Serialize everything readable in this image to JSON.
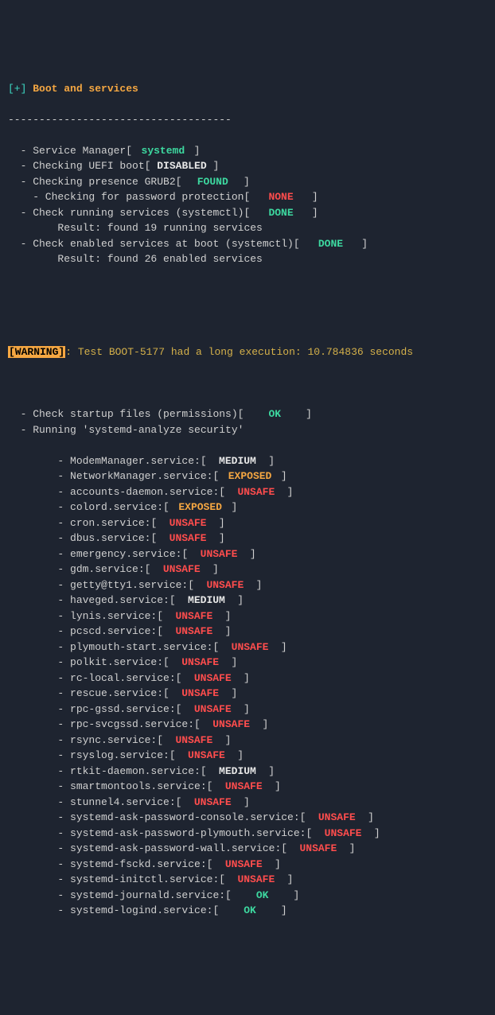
{
  "header": {
    "prefix": "[+]",
    "title": "Boot and services",
    "divider": "------------------------------------"
  },
  "top_checks": [
    {
      "indent": "  - ",
      "label": "Service Manager",
      "status": "systemd",
      "cls": "green"
    },
    {
      "indent": "  - ",
      "label": "Checking UEFI boot",
      "status": "DISABLED",
      "cls": "white"
    },
    {
      "indent": "  - ",
      "label": "Checking presence GRUB2",
      "status": "FOUND",
      "cls": "green"
    },
    {
      "indent": "    - ",
      "label": "Checking for password protection",
      "status": "NONE",
      "cls": "red"
    },
    {
      "indent": "  - ",
      "label": "Check running services (systemctl)",
      "status": "DONE",
      "cls": "green"
    },
    {
      "indent": "        ",
      "label": "Result: found 19 running services",
      "status": null
    },
    {
      "indent": "  - ",
      "label": "Check enabled services at boot (systemctl)",
      "status": "DONE",
      "cls": "green"
    },
    {
      "indent": "        ",
      "label": "Result: found 26 enabled services",
      "status": null
    }
  ],
  "warning": {
    "tag": "[WARNING]",
    "text": ": Test BOOT-5177 had a long execution: 10.784836 seconds"
  },
  "mid_checks": [
    {
      "indent": "  - ",
      "label": "Check startup files (permissions)",
      "status": "OK",
      "cls": "green"
    },
    {
      "indent": "  - ",
      "label": "Running 'systemd-analyze security'",
      "status": null
    }
  ],
  "services": [
    {
      "name": "ModemManager.service:",
      "status": "MEDIUM",
      "cls": "white"
    },
    {
      "name": "NetworkManager.service:",
      "status": "EXPOSED",
      "cls": "orange"
    },
    {
      "name": "accounts-daemon.service:",
      "status": "UNSAFE",
      "cls": "red"
    },
    {
      "name": "colord.service:",
      "status": "EXPOSED",
      "cls": "orange"
    },
    {
      "name": "cron.service:",
      "status": "UNSAFE",
      "cls": "red"
    },
    {
      "name": "dbus.service:",
      "status": "UNSAFE",
      "cls": "red"
    },
    {
      "name": "emergency.service:",
      "status": "UNSAFE",
      "cls": "red"
    },
    {
      "name": "gdm.service:",
      "status": "UNSAFE",
      "cls": "red"
    },
    {
      "name": "getty@tty1.service:",
      "status": "UNSAFE",
      "cls": "red"
    },
    {
      "name": "haveged.service:",
      "status": "MEDIUM",
      "cls": "white"
    },
    {
      "name": "lynis.service:",
      "status": "UNSAFE",
      "cls": "red"
    },
    {
      "name": "pcscd.service:",
      "status": "UNSAFE",
      "cls": "red"
    },
    {
      "name": "plymouth-start.service:",
      "status": "UNSAFE",
      "cls": "red"
    },
    {
      "name": "polkit.service:",
      "status": "UNSAFE",
      "cls": "red"
    },
    {
      "name": "rc-local.service:",
      "status": "UNSAFE",
      "cls": "red"
    },
    {
      "name": "rescue.service:",
      "status": "UNSAFE",
      "cls": "red"
    },
    {
      "name": "rpc-gssd.service:",
      "status": "UNSAFE",
      "cls": "red"
    },
    {
      "name": "rpc-svcgssd.service:",
      "status": "UNSAFE",
      "cls": "red"
    },
    {
      "name": "rsync.service:",
      "status": "UNSAFE",
      "cls": "red"
    },
    {
      "name": "rsyslog.service:",
      "status": "UNSAFE",
      "cls": "red"
    },
    {
      "name": "rtkit-daemon.service:",
      "status": "MEDIUM",
      "cls": "white"
    },
    {
      "name": "smartmontools.service:",
      "status": "UNSAFE",
      "cls": "red"
    },
    {
      "name": "stunnel4.service:",
      "status": "UNSAFE",
      "cls": "red"
    },
    {
      "name": "systemd-ask-password-console.service:",
      "status": "UNSAFE",
      "cls": "red"
    },
    {
      "name": "systemd-ask-password-plymouth.service:",
      "status": "UNSAFE",
      "cls": "red"
    },
    {
      "name": "systemd-ask-password-wall.service:",
      "status": "UNSAFE",
      "cls": "red"
    },
    {
      "name": "systemd-fsckd.service:",
      "status": "UNSAFE",
      "cls": "red"
    },
    {
      "name": "systemd-initctl.service:",
      "status": "UNSAFE",
      "cls": "red"
    },
    {
      "name": "systemd-journald.service:",
      "status": "OK",
      "cls": "green"
    },
    {
      "name": "systemd-logind.service:",
      "status": "OK",
      "cls": "green"
    }
  ]
}
